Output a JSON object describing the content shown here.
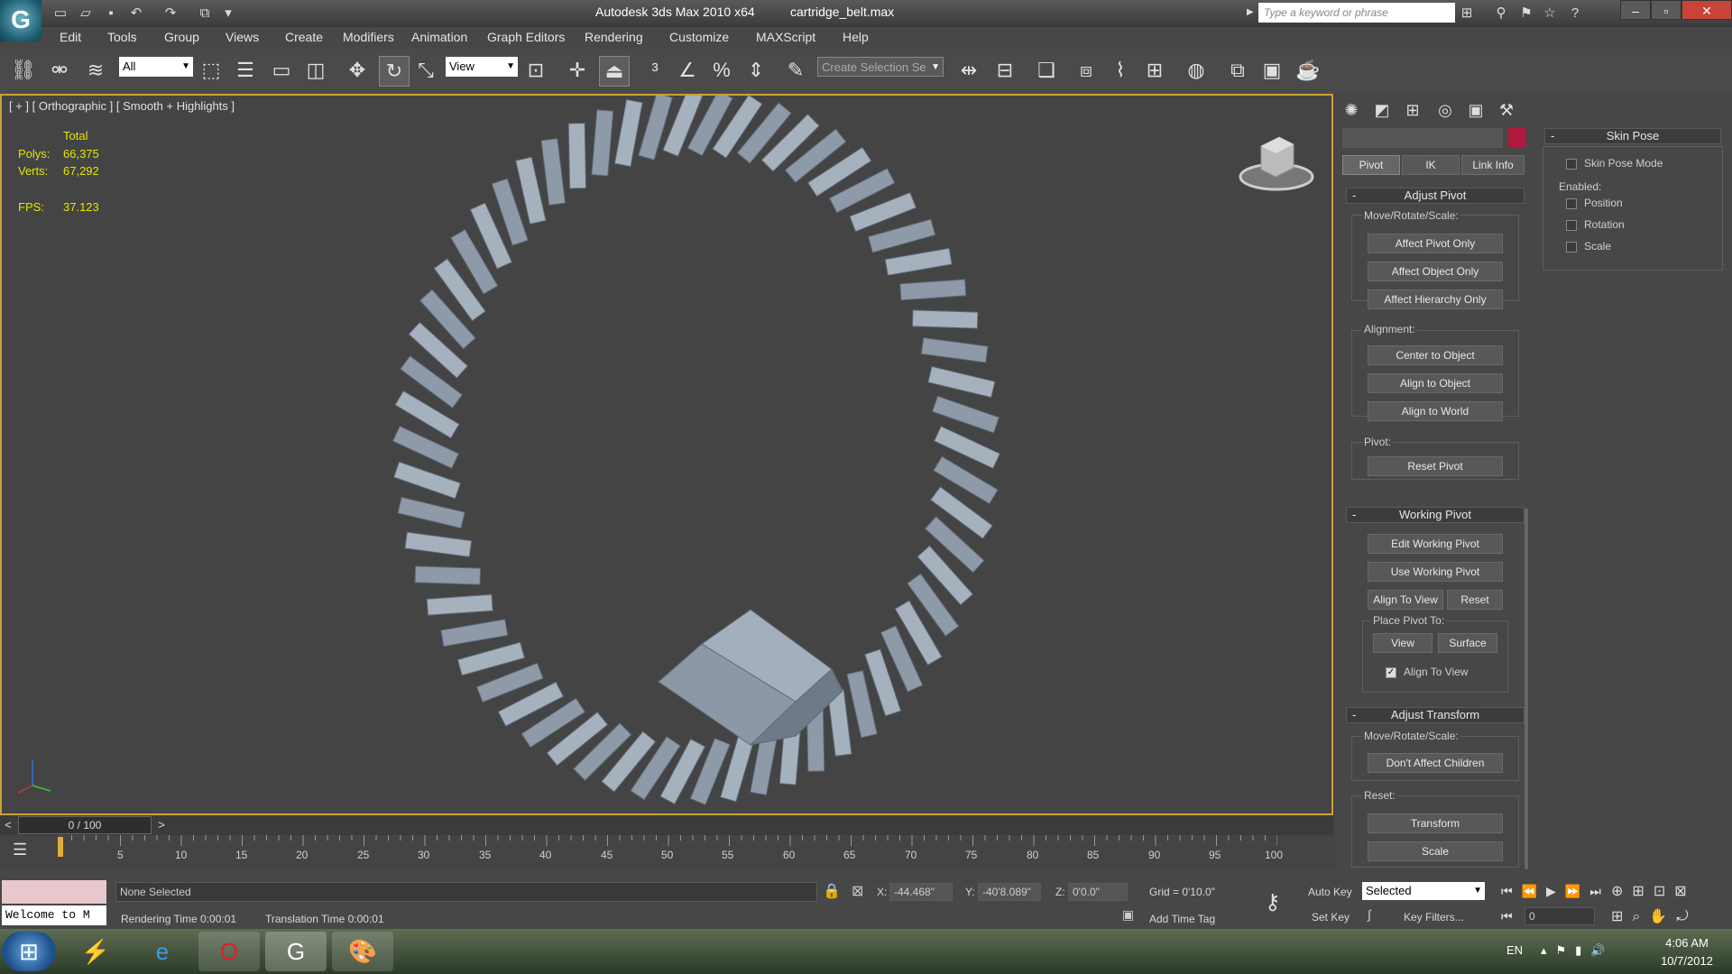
{
  "title_bar": {
    "app_title": "Autodesk 3ds Max  2010 x64",
    "file_name": "cartridge_belt.max",
    "search_placeholder": "Type a keyword or phrase",
    "logo_letter": "G"
  },
  "menu": [
    "Edit",
    "Tools",
    "Group",
    "Views",
    "Create",
    "Modifiers",
    "Animation",
    "Graph Editors",
    "Rendering",
    "Customize",
    "MAXScript",
    "Help"
  ],
  "toolbar": {
    "selection_filter": "All",
    "ref_coord": "View",
    "named_selection_placeholder": "Create Selection Se"
  },
  "viewport": {
    "label": "[ + ] [ Orthographic ] [ Smooth + Highlights ]",
    "stats": {
      "total_label": "Total",
      "polys_label": "Polys:",
      "polys": "66,375",
      "verts_label": "Verts:",
      "verts": "67,292",
      "fps_label": "FPS:",
      "fps": "37.123"
    }
  },
  "command_panel": {
    "tabs": [
      "Pivot",
      "IK",
      "Link Info"
    ],
    "active_tab": "Pivot",
    "name_field": "",
    "color_swatch": "#b0183c",
    "adjust_pivot": {
      "title": "Adjust Pivot",
      "move_rotate_scale": "Move/Rotate/Scale:",
      "affect_pivot_only": "Affect Pivot Only",
      "affect_object_only": "Affect Object Only",
      "affect_hierarchy_only": "Affect Hierarchy Only",
      "alignment": "Alignment:",
      "center_to_object": "Center to Object",
      "align_to_object": "Align to Object",
      "align_to_world": "Align to World",
      "pivot": "Pivot:",
      "reset_pivot": "Reset Pivot"
    },
    "working_pivot": {
      "title": "Working Pivot",
      "edit_working_pivot": "Edit Working Pivot",
      "use_working_pivot": "Use Working Pivot",
      "align_to_view": "Align To View",
      "reset": "Reset",
      "place_pivot_to": "Place Pivot To:",
      "view": "View",
      "surface": "Surface",
      "align_to_view_check": "Align To View",
      "align_to_view_checked": true
    },
    "adjust_transform": {
      "title": "Adjust Transform",
      "move_rotate_scale": "Move/Rotate/Scale:",
      "dont_affect_children": "Don't Affect Children",
      "reset": "Reset:",
      "transform": "Transform",
      "scale": "Scale"
    }
  },
  "skin_pose": {
    "title": "Skin Pose",
    "skin_pose_mode": "Skin Pose Mode",
    "enabled": "Enabled:",
    "position": "Position",
    "rotation": "Rotation",
    "scale": "Scale"
  },
  "timeline": {
    "frame": "0 / 100",
    "ticks": [
      "5",
      "10",
      "15",
      "20",
      "25",
      "30",
      "35",
      "40",
      "45",
      "50",
      "55",
      "60",
      "65",
      "70",
      "75",
      "80",
      "85",
      "90",
      "95",
      "100"
    ]
  },
  "status": {
    "maxscript_text": "Welcome to M",
    "selection": "None Selected",
    "rendering_time": "Rendering Time  0:00:01",
    "translation_time": "Translation Time  0:00:01",
    "x_label": "X:",
    "x": "-44.468\"",
    "y_label": "Y:",
    "y": "-40'8.089\"",
    "z_label": "Z:",
    "z": "0'0.0\"",
    "grid": "Grid = 0'10.0\"",
    "add_time_tag": "Add Time Tag",
    "auto_key": "Auto Key",
    "set_key": "Set Key",
    "key_mode": "Selected",
    "key_filters": "Key Filters...",
    "current_frame": "0"
  },
  "taskbar": {
    "language": "EN",
    "time": "4:06 AM",
    "date": "10/7/2012"
  }
}
